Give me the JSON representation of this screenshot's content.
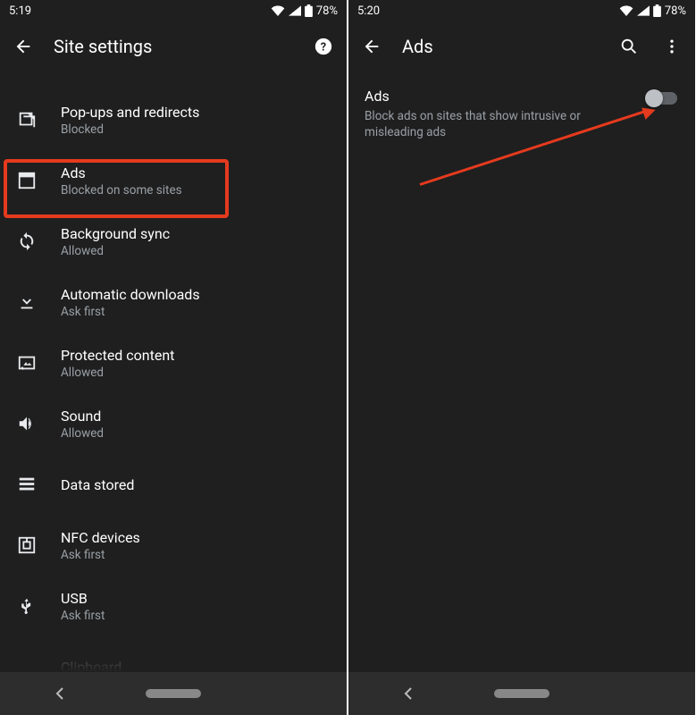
{
  "left": {
    "status": {
      "time": "5:19",
      "battery": "78%"
    },
    "title": "Site settings",
    "items": [
      {
        "title": "Pop-ups and redirects",
        "sub": "Blocked",
        "icon": "popup"
      },
      {
        "title": "Ads",
        "sub": "Blocked on some sites",
        "icon": "ads"
      },
      {
        "title": "Background sync",
        "sub": "Allowed",
        "icon": "sync"
      },
      {
        "title": "Automatic downloads",
        "sub": "Ask first",
        "icon": "download"
      },
      {
        "title": "Protected content",
        "sub": "Allowed",
        "icon": "protected"
      },
      {
        "title": "Sound",
        "sub": "Allowed",
        "icon": "sound"
      },
      {
        "title": "Data stored",
        "sub": "",
        "icon": "data"
      },
      {
        "title": "NFC devices",
        "sub": "Ask first",
        "icon": "nfc"
      },
      {
        "title": "USB",
        "sub": "Ask first",
        "icon": "usb"
      },
      {
        "title": "Clipboard",
        "sub": "",
        "icon": "clipboard"
      }
    ]
  },
  "right": {
    "status": {
      "time": "5:20",
      "battery": "78%"
    },
    "title": "Ads",
    "ads": {
      "title": "Ads",
      "sub": "Block ads on sites that show intrusive or misleading ads"
    }
  }
}
